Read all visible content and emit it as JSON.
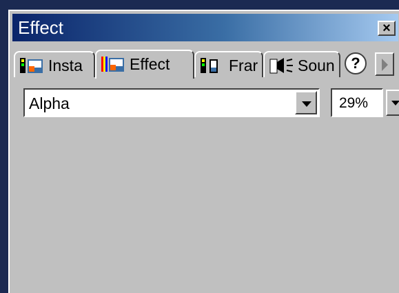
{
  "window": {
    "title": "Effect"
  },
  "tabs": [
    {
      "label": "Insta",
      "icon": "instance-icon"
    },
    {
      "label": "Effect",
      "icon": "effect-icon",
      "active": true
    },
    {
      "label": "Frar",
      "icon": "frame-icon"
    },
    {
      "label": "Soun",
      "icon": "sound-icon"
    }
  ],
  "effect_select": {
    "value": "Alpha"
  },
  "alpha_value": {
    "value": "29%"
  },
  "icons": {
    "help": "?",
    "close": "×"
  }
}
